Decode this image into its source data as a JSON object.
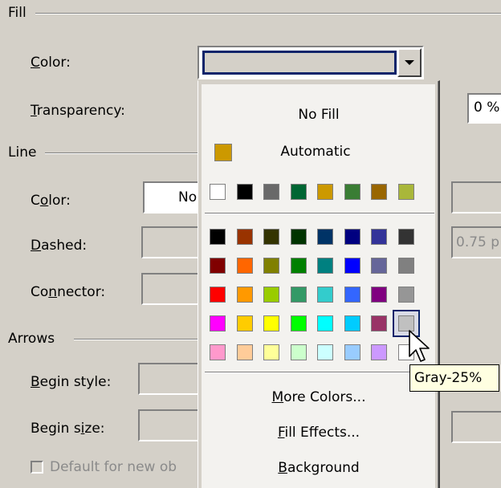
{
  "fill": {
    "group_label": "Fill",
    "color_label_prefix": "",
    "color_label_key": "C",
    "color_label_rest": "olor:",
    "transparency_label_key": "T",
    "transparency_label_rest": "ransparency:",
    "transparency_value": "0 %"
  },
  "line": {
    "group_label": "Line",
    "color_label_a": "C",
    "color_label_key": "o",
    "color_label_rest": "lor:",
    "color_value": "No",
    "dashed_label_key": "D",
    "dashed_label_rest": "ashed:",
    "weight_value": "0.75 p",
    "connector_label_a": "Co",
    "connector_label_key": "n",
    "connector_label_rest": "nector:"
  },
  "arrows": {
    "group_label": "Arrows",
    "begin_style_key": "B",
    "begin_style_rest": "egin style:",
    "begin_size_a": "Begin s",
    "begin_size_key": "i",
    "begin_size_rest": "ze:"
  },
  "default_checkbox_label": "Default for new ob",
  "popup": {
    "no_fill": "No Fill",
    "automatic": "Automatic",
    "more_colors_key": "M",
    "more_colors_rest": "ore Colors...",
    "fill_effects_key": "F",
    "fill_effects_rest": "ill Effects...",
    "background_key": "B",
    "background_rest": "ackground",
    "automatic_color": "#cc9900",
    "recent_colors": [
      "#ffffff",
      "#000000",
      "#696969",
      "#006633",
      "#cc9900",
      "#3a7d34",
      "#996600",
      "#a9b73a"
    ],
    "palette": [
      [
        "#000000",
        "#993300",
        "#333300",
        "#003300",
        "#003366",
        "#000080",
        "#333399",
        "#333333"
      ],
      [
        "#800000",
        "#ff6600",
        "#808000",
        "#008000",
        "#008080",
        "#0000ff",
        "#666699",
        "#808080"
      ],
      [
        "#ff0000",
        "#ff9900",
        "#99cc00",
        "#339966",
        "#33cccc",
        "#3366ff",
        "#800080",
        "#969696"
      ],
      [
        "#ff00ff",
        "#ffcc00",
        "#ffff00",
        "#00ff00",
        "#00ffff",
        "#00ccff",
        "#993366",
        "#c0c0c0"
      ],
      [
        "#ff99cc",
        "#ffcc99",
        "#ffff99",
        "#ccffcc",
        "#ccffff",
        "#99ccff",
        "#cc99ff",
        "#ffffff"
      ]
    ],
    "hovered_color_name": "Gray-25%"
  }
}
